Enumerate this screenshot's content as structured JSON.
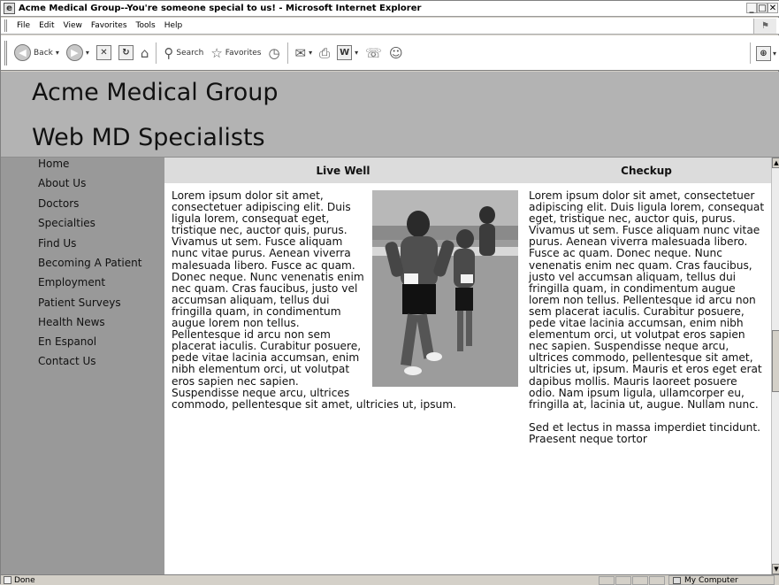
{
  "window": {
    "title": "Acme Medical Group--You're someone special to us! - Microsoft Internet Explorer",
    "controls": {
      "minimize": "_",
      "maximize": "□",
      "close": "✕"
    }
  },
  "menu": [
    "File",
    "Edit",
    "View",
    "Favorites",
    "Tools",
    "Help"
  ],
  "toolbar": {
    "back_label": "Back",
    "search_label": "Search",
    "favorites_label": "Favorites"
  },
  "site": {
    "title": "Acme Medical Group",
    "subtitle": "Web MD Specialists"
  },
  "nav": [
    "Home",
    "About Us",
    "Doctors",
    "Specialties",
    "Find Us",
    "Becoming A Patient",
    "Employment",
    "Patient Surveys",
    "Health News",
    "En Espanol",
    "Contact Us"
  ],
  "columns": {
    "live_well": {
      "heading": "Live Well",
      "body": "Lorem ipsum dolor sit amet, consectetuer adipiscing elit. Duis ligula lorem, consequat eget, tristique nec, auctor quis, purus. Vivamus ut sem. Fusce aliquam nunc vitae purus. Aenean viverra malesuada libero. Fusce ac quam. Donec neque. Nunc venenatis enim nec quam. Cras faucibus, justo vel accumsan aliquam, tellus dui fringilla quam, in condimentum augue lorem non tellus. Pellentesque id arcu non sem placerat iaculis. Curabitur posuere, pede vitae lacinia accumsan, enim nibh elementum orci, ut volutpat eros sapien nec sapien. Suspendisse neque arcu, ultrices commodo, pellentesque sit amet, ultricies ut, ipsum."
    },
    "checkup": {
      "heading": "Checkup",
      "body": "Lorem ipsum dolor sit amet, consectetuer adipiscing elit. Duis ligula lorem, consequat eget, tristique nec, auctor quis, purus. Vivamus ut sem. Fusce aliquam nunc vitae purus. Aenean viverra malesuada libero. Fusce ac quam. Donec neque. Nunc venenatis enim nec quam. Cras faucibus, justo vel accumsan aliquam, tellus dui fringilla quam, in condimentum augue lorem non tellus. Pellentesque id arcu non sem placerat iaculis. Curabitur posuere, pede vitae lacinia accumsan, enim nibh elementum orci, ut volutpat eros sapien nec sapien. Suspendisse neque arcu, ultrices commodo, pellentesque sit amet, ultricies ut, ipsum. Mauris et eros eget erat dapibus mollis. Mauris laoreet posuere odio. Nam ipsum ligula, ullamcorper eu, fringilla at, lacinia ut, augue. Nullam nunc.",
      "body2": "Sed et lectus in massa imperdiet tincidunt. Praesent neque tortor"
    }
  },
  "status": {
    "text": "Done",
    "zone": "My Computer"
  },
  "colors": {
    "banner_bg": "#b3b3b3",
    "sidebar_bg": "#999999",
    "column_header_bg": "#dcdcdc",
    "content_bg": "#ffffff"
  }
}
